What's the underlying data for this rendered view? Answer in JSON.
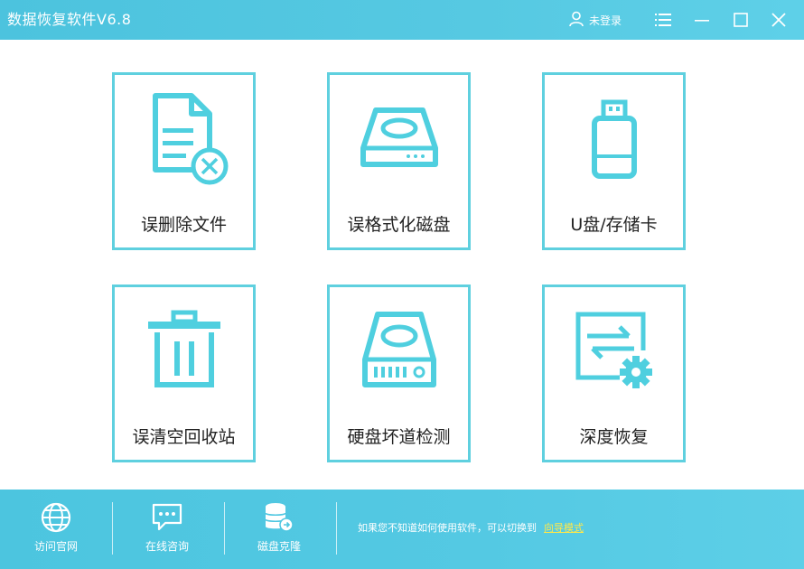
{
  "window": {
    "title": "数据恢复软件V6.8",
    "user_label": "未登录"
  },
  "cards": [
    {
      "label": "误删除文件",
      "icon": "deleted-file-icon"
    },
    {
      "label": "误格式化磁盘",
      "icon": "disk-icon"
    },
    {
      "label": "U盘/存储卡",
      "icon": "usb-drive-icon"
    },
    {
      "label": "误清空回收站",
      "icon": "trash-icon"
    },
    {
      "label": "硬盘坏道检测",
      "icon": "hard-drive-icon"
    },
    {
      "label": "深度恢复",
      "icon": "deep-recovery-icon"
    }
  ],
  "footer": {
    "buttons": [
      {
        "label": "访问官网",
        "icon": "globe-icon"
      },
      {
        "label": "在线咨询",
        "icon": "chat-icon"
      },
      {
        "label": "磁盘克隆",
        "icon": "database-clone-icon"
      }
    ],
    "hint_text": "如果您不知道如何使用软件，可以切换到",
    "hint_link": "向导模式"
  },
  "colors": {
    "accent": "#56c9e2",
    "card_border": "#5fd0df",
    "icon": "#4fcfdf",
    "link": "#ffe84a"
  }
}
